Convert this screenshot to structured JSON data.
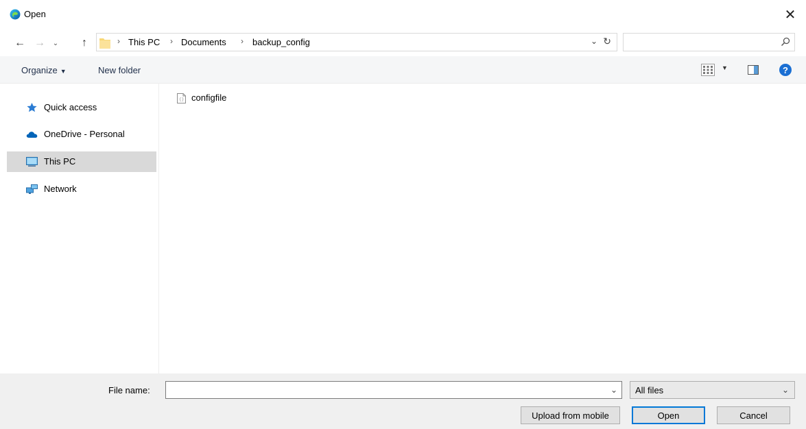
{
  "window": {
    "title": "Open",
    "close_glyph": "✕",
    "app_icon": "edge-icon"
  },
  "navigation": {
    "back_glyph": "←",
    "forward_glyph": "→",
    "recent_glyph": "⌄",
    "up_glyph": "↑"
  },
  "address": {
    "breadcrumbs": [
      "This PC",
      "Documents",
      "backup_config"
    ],
    "separator": "›",
    "dropdown_glyph": "⌄",
    "refresh_glyph": "↻"
  },
  "search": {
    "placeholder": "",
    "icon": "search-icon"
  },
  "toolbar": {
    "organize_label": "Organize",
    "organize_caret": "▼",
    "new_folder_label": "New folder",
    "views_caret": "▼",
    "help_glyph": "?"
  },
  "sidebar": {
    "items": [
      {
        "label": "Quick access",
        "icon": "star-icon",
        "selected": false
      },
      {
        "label": "OneDrive - Personal",
        "icon": "cloud-icon",
        "selected": false
      },
      {
        "label": "This PC",
        "icon": "monitor-icon",
        "selected": true
      },
      {
        "label": "Network",
        "icon": "network-icon",
        "selected": false
      }
    ]
  },
  "files": [
    {
      "name": "configfile",
      "icon": "file-icon"
    }
  ],
  "footer": {
    "file_name_label": "File name:",
    "file_name_value": "",
    "file_name_dropdown_glyph": "⌄",
    "file_type_value": "All files",
    "file_type_caret": "⌄",
    "upload_label": "Upload from mobile",
    "open_label": "Open",
    "cancel_label": "Cancel"
  },
  "colors": {
    "accent": "#0078d7",
    "help": "#1a6fd3",
    "folder": "#f8d775",
    "selected_bg": "#d9d9d9",
    "onedrive": "#0364b8"
  }
}
